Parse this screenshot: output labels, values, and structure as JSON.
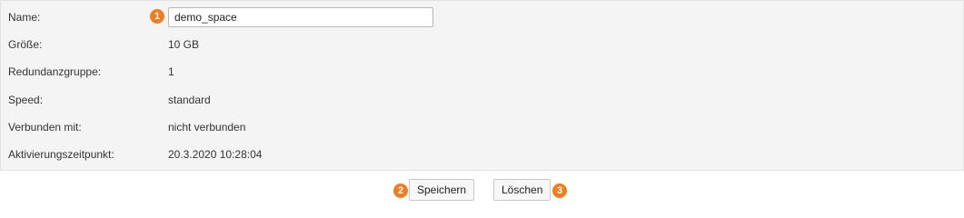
{
  "form": {
    "name": {
      "label": "Name:",
      "value": "demo_space"
    },
    "rows": [
      {
        "label": "Größe:",
        "value": "10 GB"
      },
      {
        "label": "Redundanzgruppe:",
        "value": "1"
      },
      {
        "label": "Speed:",
        "value": "standard"
      },
      {
        "label": "Verbunden mit:",
        "value": "nicht verbunden"
      },
      {
        "label": "Aktivierungszeitpunkt:",
        "value": "20.3.2020 10:28:04"
      }
    ]
  },
  "actions": {
    "save_label": "Speichern",
    "delete_label": "Löschen"
  },
  "markers": [
    "1",
    "2",
    "3"
  ],
  "colors": {
    "marker": "#ef7d22",
    "panel_background": "#f4f4f4"
  }
}
